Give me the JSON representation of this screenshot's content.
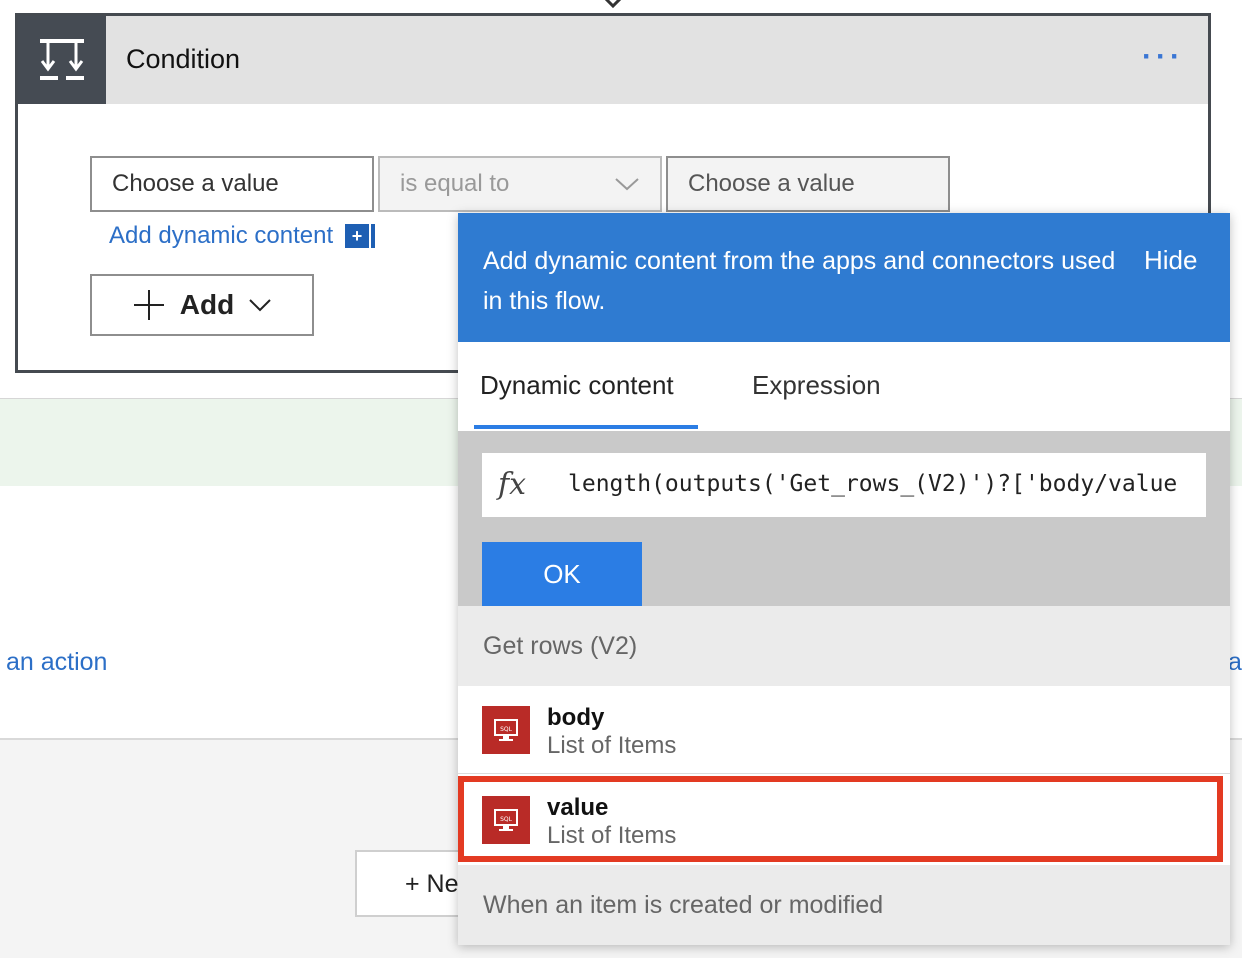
{
  "condition": {
    "title": "Condition",
    "menu_label": "···",
    "left_value_placeholder": "Choose a value",
    "operator": "is equal to",
    "right_value_placeholder": "Choose a value",
    "add_dynamic_content": "Add dynamic content",
    "add_button_label": "Add"
  },
  "background": {
    "left_link": "an action",
    "right_link_fragment": "a",
    "new_step_label": "+ Ne"
  },
  "panel": {
    "header_text": "Add dynamic content from the apps and connectors used in this flow.",
    "hide_label": "Hide",
    "tabs": [
      {
        "label": "Dynamic content",
        "active": true
      },
      {
        "label": "Expression",
        "active": false
      }
    ],
    "expression_value": "length(outputs('Get_rows_(V2)')?['body/value",
    "ok_label": "OK",
    "groups": [
      {
        "name": "Get rows (V2)",
        "items": [
          {
            "title": "body",
            "subtitle": "List of Items",
            "icon": "sql-icon"
          },
          {
            "title": "value",
            "subtitle": "List of Items",
            "icon": "sql-icon",
            "highlighted": true
          }
        ]
      },
      {
        "name": "When an item is created or modified",
        "items": []
      }
    ]
  },
  "colors": {
    "accent_blue": "#2f7bd1",
    "ok_blue": "#2b7de4",
    "sql_red": "#b92b27",
    "highlight_red": "#e33a22",
    "header_dark": "#454b53"
  }
}
